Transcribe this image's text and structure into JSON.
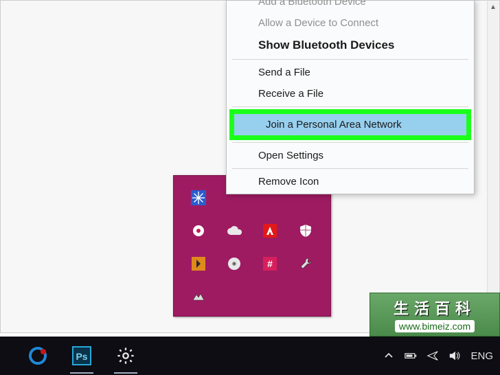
{
  "context_menu": {
    "items": [
      {
        "label": "Add a Bluetooth Device",
        "state": "disabled-truncated"
      },
      {
        "label": "Allow a Device to Connect",
        "state": "disabled"
      },
      {
        "label": "Show Bluetooth Devices",
        "state": "bold"
      },
      {
        "sep": true
      },
      {
        "label": "Send a File",
        "state": "normal"
      },
      {
        "label": "Receive a File",
        "state": "normal"
      },
      {
        "sep": true
      },
      {
        "label": "Join a Personal Area Network",
        "state": "highlighted"
      },
      {
        "sep": true
      },
      {
        "label": "Open Settings",
        "state": "normal"
      },
      {
        "sep": true
      },
      {
        "label": "Remove Icon",
        "state": "normal"
      }
    ]
  },
  "taskbar": {
    "left_buttons": [
      {
        "name": "cortana",
        "color": "#2170c8"
      },
      {
        "name": "photoshop"
      },
      {
        "name": "settings-gear"
      }
    ],
    "right": {
      "expand_arrow": "˄",
      "battery": true,
      "airplane": true,
      "volume": true,
      "ime": "ENG"
    }
  },
  "tray_icons": [
    "snowflake",
    "",
    "",
    "",
    "disk",
    "cloud",
    "adobe",
    "defender",
    "plex",
    "disc",
    "hash",
    "wrench",
    "misc",
    "",
    "",
    ""
  ],
  "watermark": {
    "zh": "生活百科",
    "url": "www.bimeiz.com"
  }
}
